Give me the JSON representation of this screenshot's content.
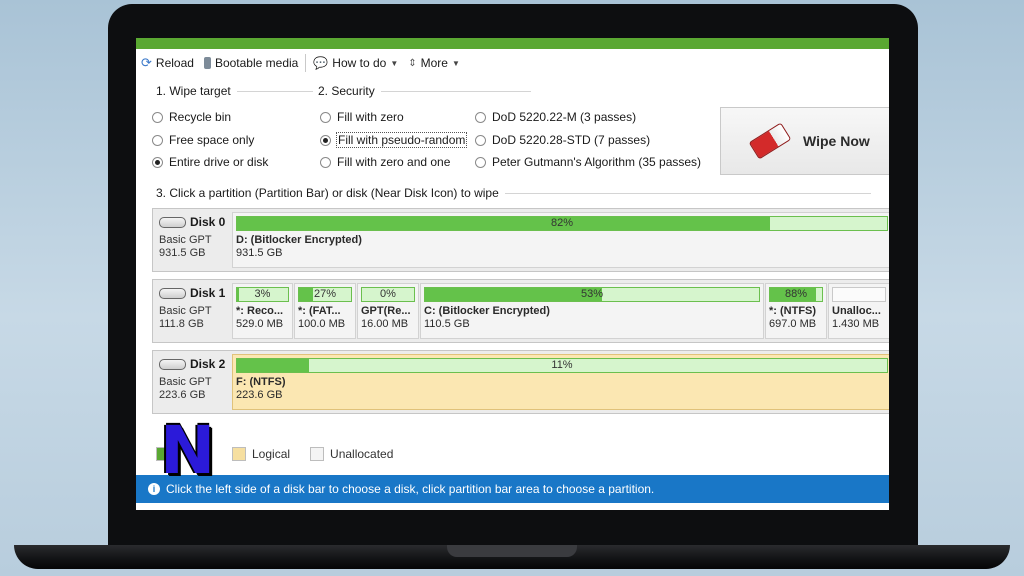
{
  "toolbar": {
    "reload": "Reload",
    "bootable": "Bootable media",
    "howto": "How to do",
    "more": "More"
  },
  "wipe_target": {
    "title": "1. Wipe target",
    "options": [
      "Recycle bin",
      "Free space only",
      "Entire drive or disk"
    ],
    "selected": "Entire drive or disk"
  },
  "security": {
    "title": "2. Security",
    "options_left": [
      "Fill with zero",
      "Fill with pseudo-random",
      "Fill with zero and one"
    ],
    "options_right": [
      "DoD 5220.22-M (3 passes)",
      "DoD 5220.28-STD (7 passes)",
      "Peter Gutmann's Algorithm (35 passes)"
    ],
    "selected": "Fill with pseudo-random"
  },
  "wipe_now": "Wipe Now",
  "section3_title": "3. Click a partition (Partition Bar) or disk (Near Disk Icon) to wipe",
  "disks": [
    {
      "name": "Disk 0",
      "type": "Basic GPT",
      "size": "931.5 GB",
      "partitions": [
        {
          "pct_label": "82%",
          "fill": 0.82,
          "name": "D: (Bitlocker Encrypted)",
          "size": "931.5 GB"
        }
      ]
    },
    {
      "name": "Disk 1",
      "type": "Basic GPT",
      "size": "111.8 GB",
      "partitions": [
        {
          "pct_label": "3%",
          "fill": 0.03,
          "name": "*: Reco...",
          "size": "529.0 MB"
        },
        {
          "pct_label": "27%",
          "fill": 0.27,
          "name": "*: (FAT...",
          "size": "100.0 MB"
        },
        {
          "pct_label": "0%",
          "fill": 0.0,
          "name": "GPT(Re...",
          "size": "16.00 MB"
        },
        {
          "pct_label": "53%",
          "fill": 0.53,
          "name": "C: (Bitlocker Encrypted)",
          "size": "110.5 GB"
        },
        {
          "pct_label": "88%",
          "fill": 0.88,
          "name": "*: (NTFS)",
          "size": "697.0 MB"
        },
        {
          "pct_label": "",
          "fill": 0.0,
          "name": "Unalloc...",
          "size": "1.430 MB"
        }
      ]
    },
    {
      "name": "Disk 2",
      "type": "Basic GPT",
      "size": "223.6 GB",
      "partitions": [
        {
          "pct_label": "11%",
          "fill": 0.11,
          "name": "F: (NTFS)",
          "size": "223.6 GB"
        }
      ]
    }
  ],
  "legend": {
    "logical": "Logical",
    "unallocated": "Unallocated"
  },
  "status_text": "Click the left side of a disk bar to choose a disk, click partition bar area to choose a partition.",
  "badge_letter": "N",
  "colors": {
    "accent_green": "#5aa832",
    "status_blue": "#1977c7",
    "selected_partition": "#fbe7b2"
  }
}
